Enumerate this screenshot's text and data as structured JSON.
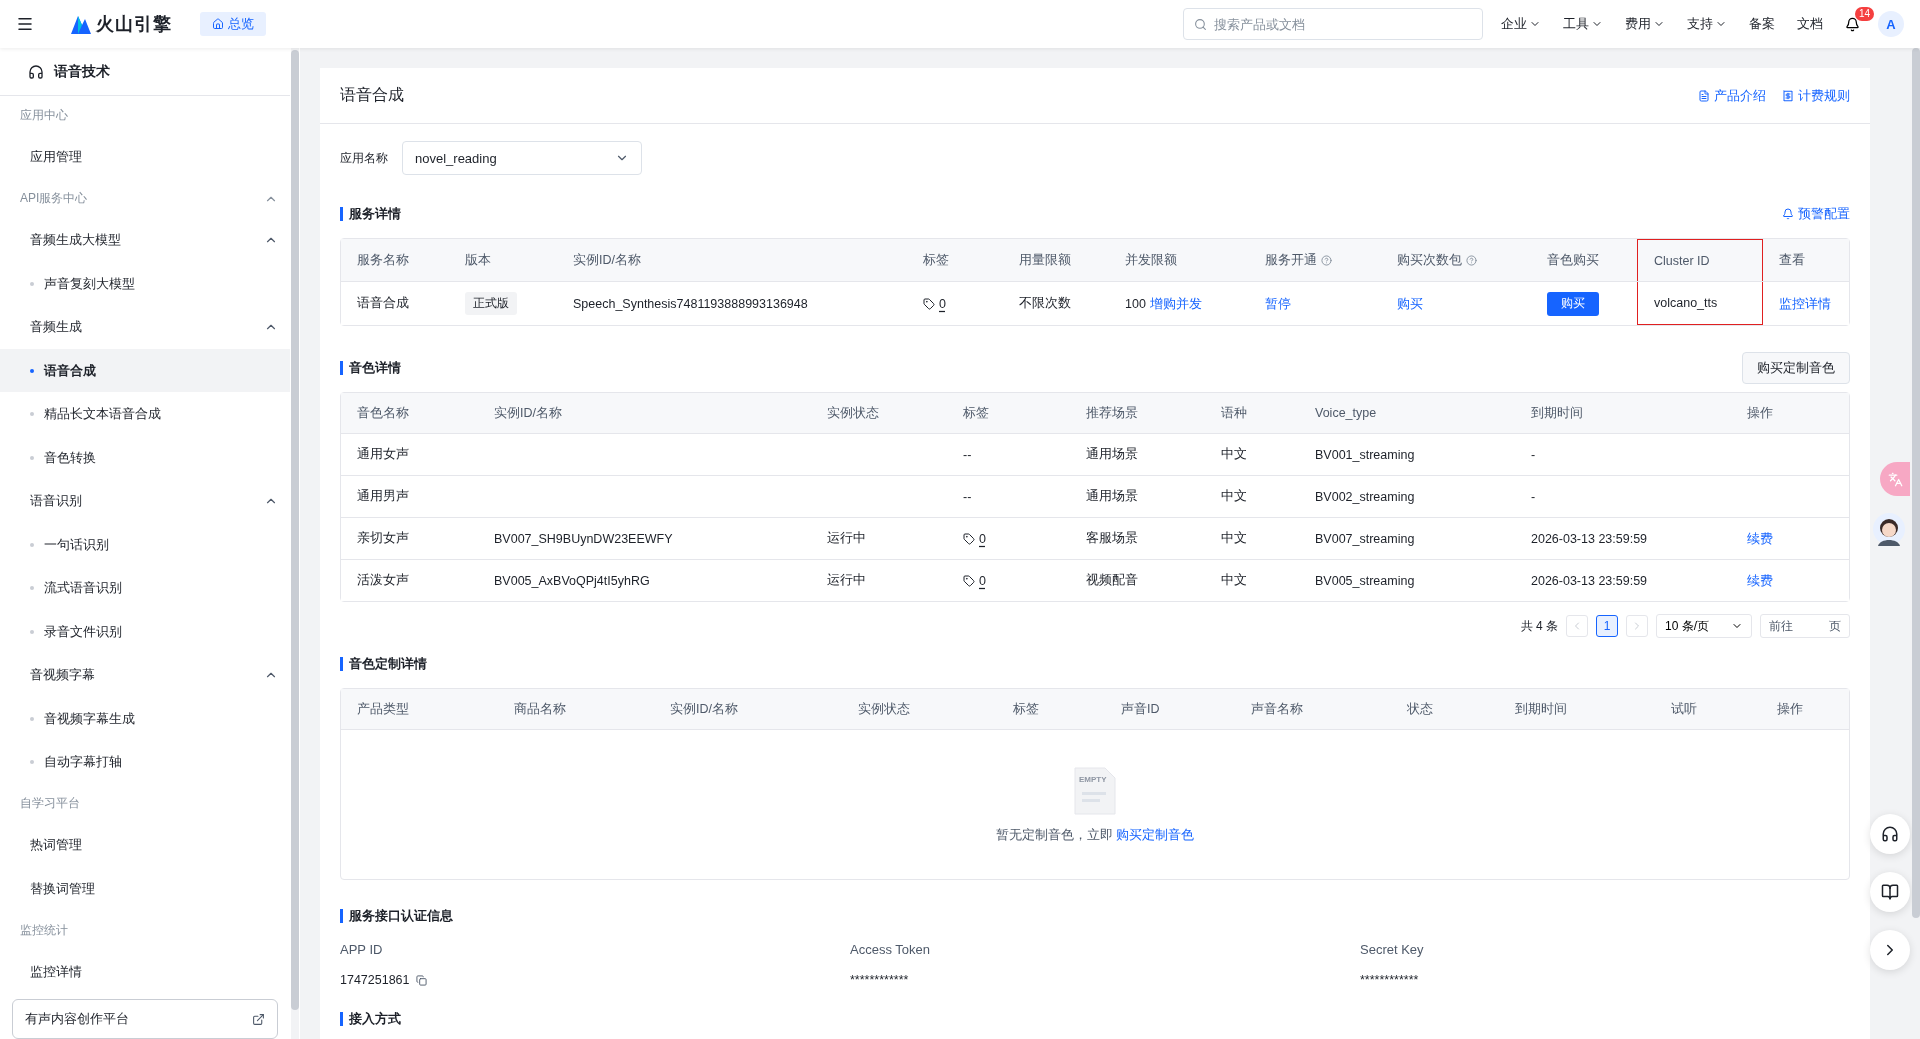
{
  "topbar": {
    "brand": "火山引擎",
    "home_tab": "总览",
    "search": {
      "placeholder": "搜索产品或文档"
    },
    "nav": [
      {
        "label": "企业",
        "dropdown": true
      },
      {
        "label": "工具",
        "dropdown": true
      },
      {
        "label": "费用",
        "dropdown": true
      },
      {
        "label": "支持",
        "dropdown": true
      },
      {
        "label": "备案",
        "dropdown": false
      },
      {
        "label": "文档",
        "dropdown": false
      }
    ],
    "notification_count": "14",
    "avatar": "A"
  },
  "sidebar": {
    "title": "语音技术",
    "sections": [
      {
        "label": "应用中心",
        "children": [
          {
            "label": "应用管理",
            "selected": false
          }
        ]
      },
      {
        "label": "API服务中心",
        "expanded": true,
        "children": [
          {
            "label": "音频生成大模型",
            "expanded": true,
            "children": [
              {
                "label": "声音复刻大模型",
                "selected": false
              }
            ]
          },
          {
            "label": "音频生成",
            "expanded": true,
            "children": [
              {
                "label": "语音合成",
                "selected": true
              },
              {
                "label": "精品长文本语音合成",
                "selected": false
              },
              {
                "label": "音色转换",
                "selected": false
              }
            ]
          },
          {
            "label": "语音识别",
            "expanded": true,
            "children": [
              {
                "label": "一句话识别",
                "selected": false
              },
              {
                "label": "流式语音识别",
                "selected": false
              },
              {
                "label": "录音文件识别",
                "selected": false
              }
            ]
          },
          {
            "label": "音视频字幕",
            "expanded": true,
            "children": [
              {
                "label": "音视频字幕生成",
                "selected": false
              },
              {
                "label": "自动字幕打轴",
                "selected": false
              }
            ]
          }
        ]
      },
      {
        "label": "自学习平台",
        "children": [
          {
            "label": "热词管理",
            "selected": false
          },
          {
            "label": "替换词管理",
            "selected": false
          }
        ]
      },
      {
        "label": "监控统计",
        "children": [
          {
            "label": "监控详情",
            "selected": false
          }
        ]
      }
    ],
    "footer_link": "有声内容创作平台"
  },
  "page": {
    "title": "语音合成",
    "header_links": [
      "产品介绍",
      "计费规则"
    ],
    "app_select": {
      "label": "应用名称",
      "value": "novel_reading"
    },
    "service": {
      "title": "服务详情",
      "action": "预警配置",
      "columns": [
        {
          "label": "服务名称",
          "help": false,
          "highlighted": false
        },
        {
          "label": "版本",
          "help": false,
          "highlighted": false
        },
        {
          "label": "实例ID/名称",
          "help": false,
          "highlighted": false
        },
        {
          "label": "标签",
          "help": false,
          "highlighted": false
        },
        {
          "label": "用量限额",
          "help": false,
          "highlighted": false
        },
        {
          "label": "并发限额",
          "help": false,
          "highlighted": false
        },
        {
          "label": "服务开通",
          "help": true,
          "highlighted": false
        },
        {
          "label": "购买次数包",
          "help": true,
          "highlighted": false
        },
        {
          "label": "音色购买",
          "help": false,
          "highlighted": false
        },
        {
          "label": "Cluster ID",
          "help": false,
          "highlighted": true
        },
        {
          "label": "查看",
          "help": false,
          "highlighted": false
        }
      ],
      "row": [
        {
          "kind": "text",
          "text": "语音合成"
        },
        {
          "kind": "badge",
          "text": "正式版"
        },
        {
          "kind": "text",
          "text": "Speech_Synthesis7481193888993136948"
        },
        {
          "kind": "tag",
          "text": "0"
        },
        {
          "kind": "text",
          "text": "不限次数"
        },
        {
          "kind": "textlink",
          "text": "100",
          "link": "增购并发"
        },
        {
          "kind": "link",
          "text": "暂停"
        },
        {
          "kind": "link",
          "text": "购买"
        },
        {
          "kind": "button",
          "text": "购买"
        },
        {
          "kind": "text",
          "text": "volcano_tts"
        },
        {
          "kind": "link",
          "text": "监控详情"
        }
      ]
    },
    "voices": {
      "title": "音色详情",
      "action": "购买定制音色",
      "columns": [
        "音色名称",
        "实例ID/名称",
        "实例状态",
        "标签",
        "推荐场景",
        "语种",
        "Voice_type",
        "到期时间",
        "操作"
      ],
      "rows": [
        {
          "name": "通用女声",
          "tag": {
            "kind": "dash",
            "text": "--"
          },
          "scene": "通用场景",
          "language": "中文",
          "voice_type": "BV001_streaming",
          "expiry": "-"
        },
        {
          "name": "通用男声",
          "tag": {
            "kind": "dash",
            "text": "--"
          },
          "scene": "通用场景",
          "language": "中文",
          "voice_type": "BV002_streaming",
          "expiry": "-"
        },
        {
          "name": "亲切女声",
          "instance": "BV007_SH9BUynDW23EEWFY",
          "status": "运行中",
          "tag": {
            "kind": "tag",
            "text": "0"
          },
          "scene": "客服场景",
          "language": "中文",
          "voice_type": "BV007_streaming",
          "expiry": "2026-03-13 23:59:59",
          "action": "续费"
        },
        {
          "name": "活泼女声",
          "instance": "BV005_AxBVoQPj4tI5yhRG",
          "status": "运行中",
          "tag": {
            "kind": "tag",
            "text": "0"
          },
          "scene": "视频配音",
          "language": "中文",
          "voice_type": "BV005_streaming",
          "expiry": "2026-03-13 23:59:59",
          "action": "续费"
        }
      ],
      "pagination": {
        "total": "共 4 条",
        "pages": [
          {
            "label": "1",
            "selected": true
          }
        ],
        "page_size": "10 条/页",
        "goto": "前往",
        "goto_suffix": "页"
      }
    },
    "custom": {
      "title": "音色定制详情",
      "columns": [
        "产品类型",
        "商品名称",
        "实例ID/名称",
        "实例状态",
        "标签",
        "声音ID",
        "声音名称",
        "状态",
        "到期时间",
        "试听",
        "操作"
      ],
      "empty": {
        "image_text": "EMPTY",
        "text": "暂无定制音色，立即",
        "link": "购买定制音色"
      }
    },
    "auth": {
      "title": "服务接口认证信息",
      "fields": [
        {
          "label": "APP ID",
          "value": "1747251861",
          "kind": "copyable"
        },
        {
          "label": "Access Token",
          "value": "************",
          "kind": "plain"
        },
        {
          "label": "Secret Key",
          "value": "************",
          "kind": "plain"
        }
      ]
    },
    "next_section": "接入方式"
  }
}
